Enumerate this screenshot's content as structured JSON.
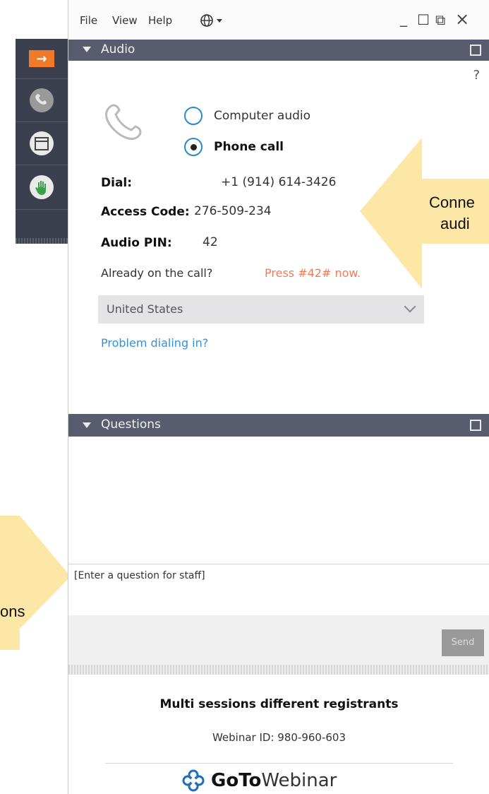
{
  "menu": {
    "file": "File",
    "view": "View",
    "help": "Help"
  },
  "window_controls": {
    "minimize": "_",
    "maximize": "☐",
    "popout": "⧉",
    "close": "×"
  },
  "audio_panel": {
    "title": "Audio",
    "help": "?",
    "options": [
      {
        "label": "Computer audio",
        "selected": false
      },
      {
        "label": "Phone call",
        "selected": true
      }
    ],
    "dial_label": "Dial:",
    "dial_value": "+1 (914) 614-3426",
    "access_label": "Access Code:",
    "access_value": "276-509-234",
    "pin_label": "Audio PIN:",
    "pin_value": "42",
    "already_text": "Already on the call?",
    "press_text": "Press #42# now.",
    "country": "United States",
    "problem_link": "Problem dialing in?"
  },
  "questions_panel": {
    "title": "Questions",
    "input_placeholder": "[Enter a question for staff]",
    "send_label": "Send"
  },
  "footer": {
    "session_title": "Multi sessions different registrants",
    "webinar_id": "Webinar ID: 980-960-603",
    "brand_bold": "GoTo",
    "brand_light": "Webinar"
  },
  "callouts": {
    "right_text_line1": "Conne",
    "right_text_line2": "audi",
    "left_text": "ons"
  },
  "colors": {
    "panel_header": "#585c6e",
    "toolbar": "#3c3f4d",
    "accent_orange": "#f07a2a",
    "link_blue": "#3a8fd6",
    "callout_yellow": "#fde7a6",
    "press_orange": "#f07b55"
  }
}
